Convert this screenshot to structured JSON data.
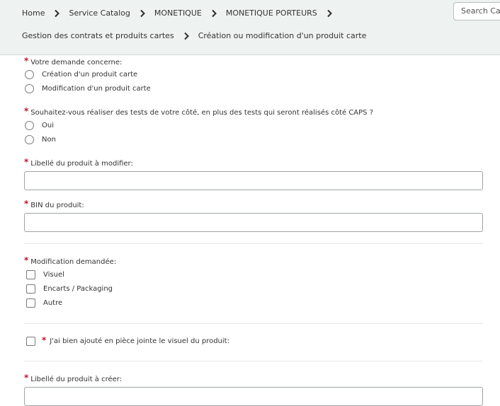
{
  "breadcrumb": {
    "row1": [
      "Home",
      "Service Catalog",
      "MONETIQUE",
      "MONETIQUE PORTEURS"
    ],
    "row2": [
      "Gestion des contrats et produits cartes",
      "Création ou modification d'un produit carte"
    ]
  },
  "search": {
    "placeholder": "Search Catalog"
  },
  "form": {
    "demande": {
      "label": "Votre demande concerne:",
      "options": [
        "Création d'un produit carte",
        "Modification d'un produit carte"
      ]
    },
    "tests": {
      "label": "Souhaitez-vous réaliser des tests de votre côté, en plus des tests qui seront réalisés côté CAPS ?",
      "options": [
        "Oui",
        "Non"
      ]
    },
    "libelle_modifier": {
      "label": "Libellé du produit à modifier:",
      "value": ""
    },
    "bin": {
      "label": "BIN du produit:",
      "value": ""
    },
    "modification": {
      "label": "Modification demandée:",
      "options": [
        "Visuel",
        "Encarts / Packaging",
        "Autre"
      ]
    },
    "visuel_ack": {
      "label": "J'ai bien ajouté en pièce jointe le visuel du produit:"
    },
    "libelle_creer": {
      "label": "Libellé du produit à créer:",
      "value": ""
    },
    "required_mark": "*"
  },
  "colors": {
    "header_bg": "#eef2f1",
    "required": "#c8102e",
    "border": "#9ea3a3"
  }
}
